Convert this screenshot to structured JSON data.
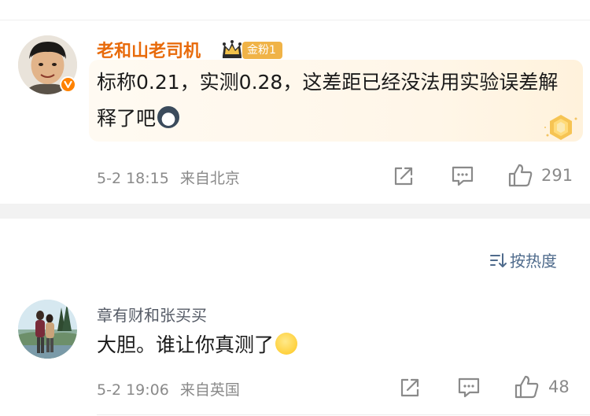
{
  "comments": [
    {
      "username": "老和山老司机",
      "fan_badge": "金粉1",
      "text": "标称0.21，实测0.28，这差距已经没法用实验误差解释了吧",
      "emoji_icon": "husky-emoji",
      "time": "5-2 18:15",
      "location": "来自北京",
      "like_count": "291",
      "verified": true
    },
    {
      "username": "章有财和张买买",
      "text": "大胆。谁让你真测了",
      "emoji_icon": "smirk-emoji",
      "time": "5-2 19:06",
      "location": "来自英国",
      "like_count": "48"
    }
  ],
  "sort": {
    "label": "按热度"
  },
  "colors": {
    "username_vip": "#e86b0c",
    "username_normal": "#555b66",
    "meta": "#8a8a8a",
    "sort_link": "#4f6b8c",
    "badge_bg": "#f0b347"
  }
}
